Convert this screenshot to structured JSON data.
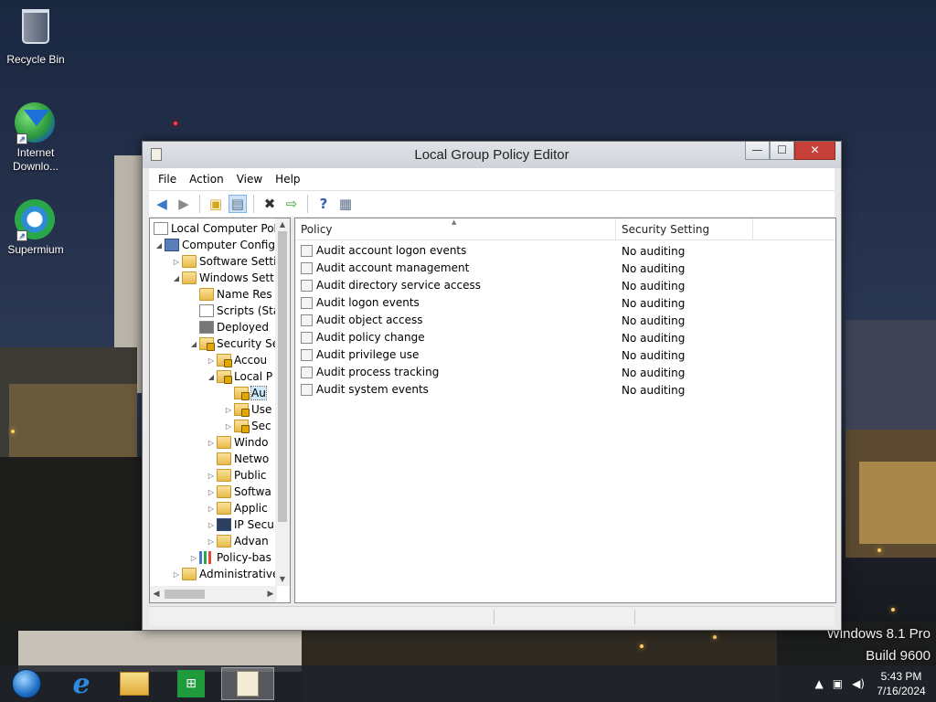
{
  "desktop": {
    "icons": [
      {
        "label": "Recycle Bin"
      },
      {
        "label": "Internet Downlo..."
      },
      {
        "label": "Supermium"
      }
    ],
    "watermark": {
      "line1": "Windows 8.1 Pro",
      "line2": "Build 9600"
    }
  },
  "window": {
    "title": "Local Group Policy Editor",
    "buttons": {
      "minimize": "—",
      "maximize": "☐",
      "close": "✕"
    },
    "menu": [
      "File",
      "Action",
      "View",
      "Help"
    ],
    "tree": [
      {
        "label": "Local Computer Polic"
      },
      {
        "label": "Computer Config"
      },
      {
        "label": "Software Setti"
      },
      {
        "label": "Windows Sett"
      },
      {
        "label": "Name Res"
      },
      {
        "label": "Scripts (Sta"
      },
      {
        "label": "Deployed"
      },
      {
        "label": "Security Se"
      },
      {
        "label": "Accou"
      },
      {
        "label": "Local P"
      },
      {
        "label": "Au"
      },
      {
        "label": "Use"
      },
      {
        "label": "Sec"
      },
      {
        "label": "Windo"
      },
      {
        "label": "Netwo"
      },
      {
        "label": "Public"
      },
      {
        "label": "Softwa"
      },
      {
        "label": "Applic"
      },
      {
        "label": "IP Secu"
      },
      {
        "label": "Advan"
      },
      {
        "label": "Policy-bas"
      },
      {
        "label": "Administrative"
      }
    ],
    "list": {
      "columns": [
        "Policy",
        "Security Setting"
      ],
      "rows": [
        {
          "policy": "Audit account logon events",
          "setting": "No auditing"
        },
        {
          "policy": "Audit account management",
          "setting": "No auditing"
        },
        {
          "policy": "Audit directory service access",
          "setting": "No auditing"
        },
        {
          "policy": "Audit logon events",
          "setting": "No auditing"
        },
        {
          "policy": "Audit object access",
          "setting": "No auditing"
        },
        {
          "policy": "Audit policy change",
          "setting": "No auditing"
        },
        {
          "policy": "Audit privilege use",
          "setting": "No auditing"
        },
        {
          "policy": "Audit process tracking",
          "setting": "No auditing"
        },
        {
          "policy": "Audit system events",
          "setting": "No auditing"
        }
      ]
    }
  },
  "taskbar": {
    "clock": {
      "time": "5:43 PM",
      "date": "7/16/2024"
    }
  }
}
